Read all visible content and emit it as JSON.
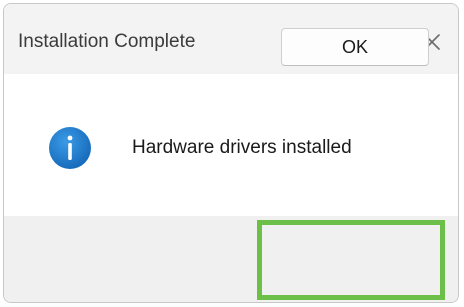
{
  "dialog": {
    "title": "Installation Complete",
    "message": "Hardware drivers installed",
    "ok_label": "OK",
    "icons": {
      "close": "close-icon",
      "info": "info-icon"
    },
    "colors": {
      "info_icon": "#1f7fd1",
      "highlight": "#6cc04a"
    }
  }
}
